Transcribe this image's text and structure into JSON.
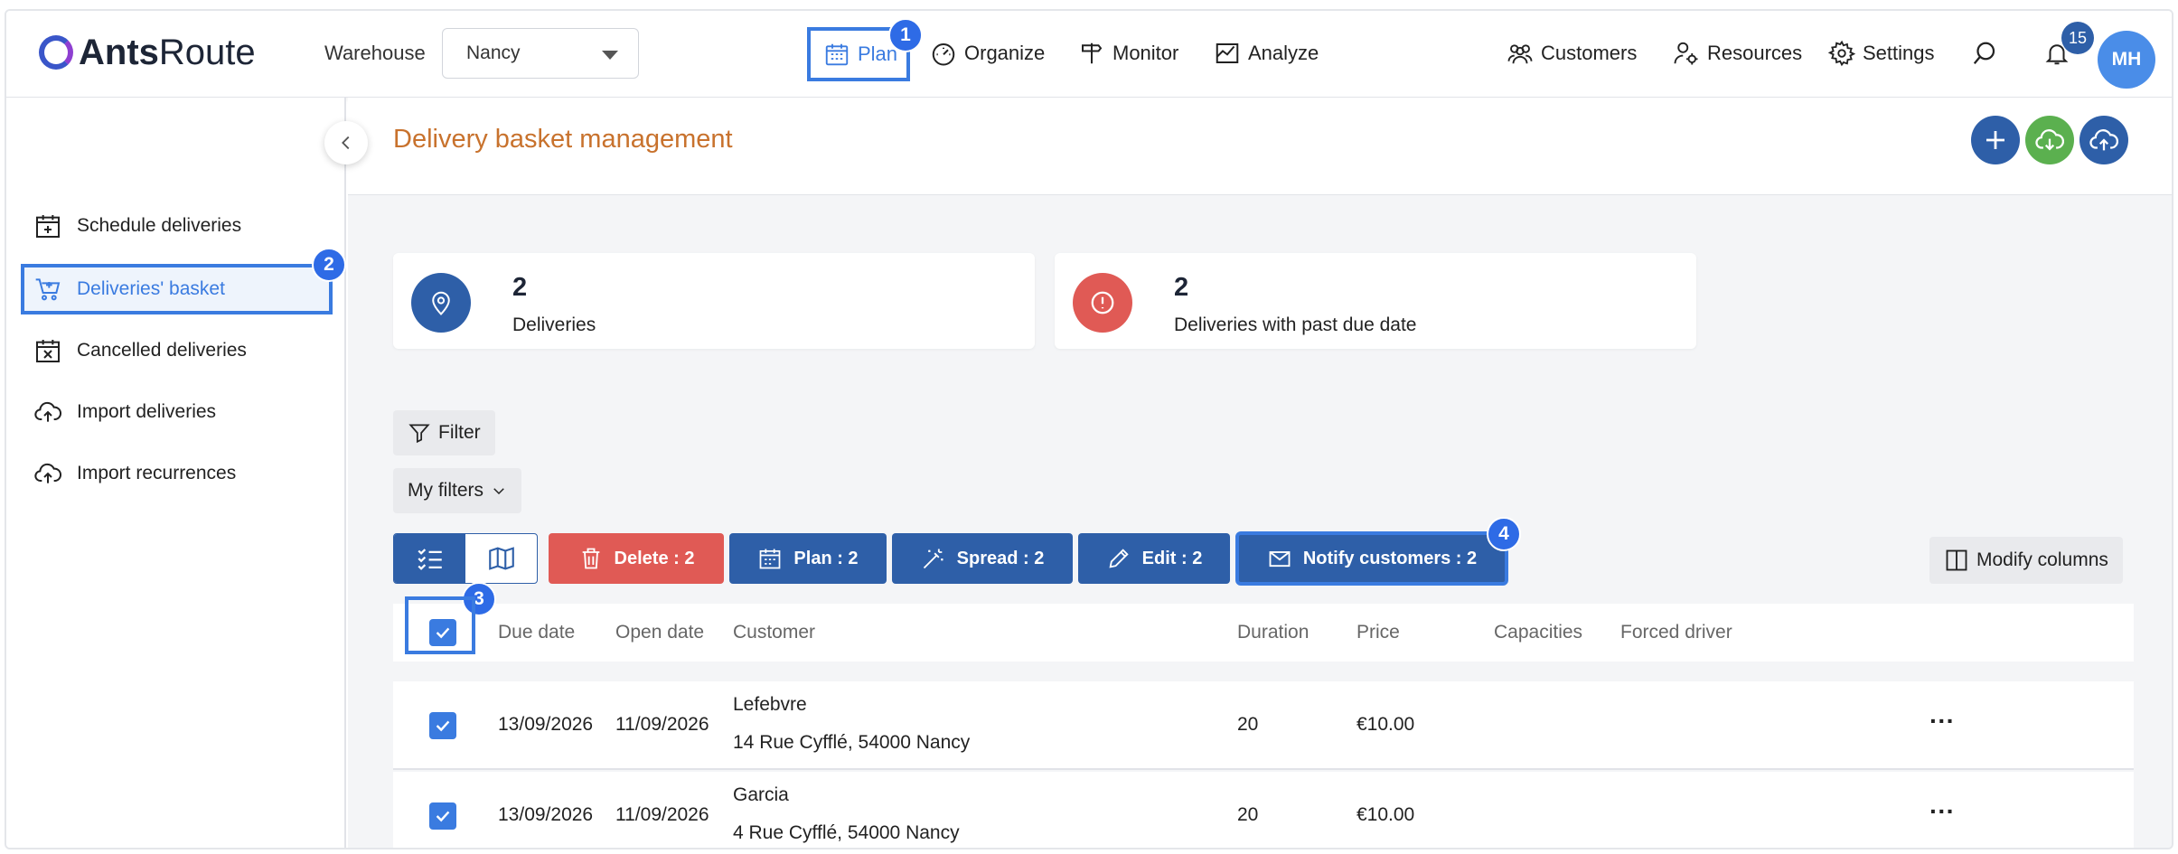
{
  "app": {
    "logo_bold": "Ants",
    "logo_light": "Route"
  },
  "header": {
    "warehouse_label": "Warehouse",
    "warehouse_value": "Nancy",
    "nav": [
      {
        "label": "Plan",
        "icon": "calendar-icon"
      },
      {
        "label": "Organize",
        "icon": "gauge-icon"
      },
      {
        "label": "Monitor",
        "icon": "signpost-icon"
      },
      {
        "label": "Analyze",
        "icon": "chart-icon"
      }
    ],
    "right_nav": [
      {
        "label": "Customers",
        "icon": "users-icon"
      },
      {
        "label": "Resources",
        "icon": "user-gear-icon"
      },
      {
        "label": "Settings",
        "icon": "gear-icon"
      }
    ],
    "notification_count": "15",
    "avatar_initials": "MH"
  },
  "annotations": {
    "a1": "1",
    "a2": "2",
    "a3": "3",
    "a4": "4"
  },
  "sidebar": {
    "items": [
      {
        "label": "Schedule deliveries",
        "icon": "calendar-plus-icon"
      },
      {
        "label": "Deliveries' basket",
        "icon": "cart-icon"
      },
      {
        "label": "Cancelled deliveries",
        "icon": "calendar-x-icon"
      },
      {
        "label": "Import deliveries",
        "icon": "cloud-upload-icon"
      },
      {
        "label": "Import recurrences",
        "icon": "cloud-upload-icon"
      }
    ]
  },
  "main": {
    "title": "Delivery basket management",
    "cards": [
      {
        "value": "2",
        "label": "Deliveries"
      },
      {
        "value": "2",
        "label": "Deliveries with past due date"
      }
    ],
    "filter_label": "Filter",
    "my_filters_label": "My filters",
    "actions": {
      "delete": "Delete : 2",
      "plan": "Plan : 2",
      "spread": "Spread : 2",
      "edit": "Edit : 2",
      "notify": "Notify customers : 2"
    },
    "modify_columns": "Modify columns",
    "columns": [
      "Due date",
      "Open date",
      "Customer",
      "Duration",
      "Price",
      "Capacities",
      "Forced driver"
    ],
    "rows": [
      {
        "due": "13/09/2026",
        "open": "11/09/2026",
        "customer": "Lefebvre",
        "address": "14 Rue Cyfflé, 54000 Nancy",
        "duration": "20",
        "price": "€10.00"
      },
      {
        "due": "13/09/2026",
        "open": "11/09/2026",
        "customer": "Garcia",
        "address": "4 Rue Cyfflé, 54000 Nancy",
        "duration": "20",
        "price": "€10.00"
      }
    ],
    "more_label": "···"
  },
  "colors": {
    "accent": "#3a7be0",
    "primary": "#2e5fa8",
    "danger": "#e05a55",
    "success": "#5bb04f",
    "title": "#c8722d"
  }
}
